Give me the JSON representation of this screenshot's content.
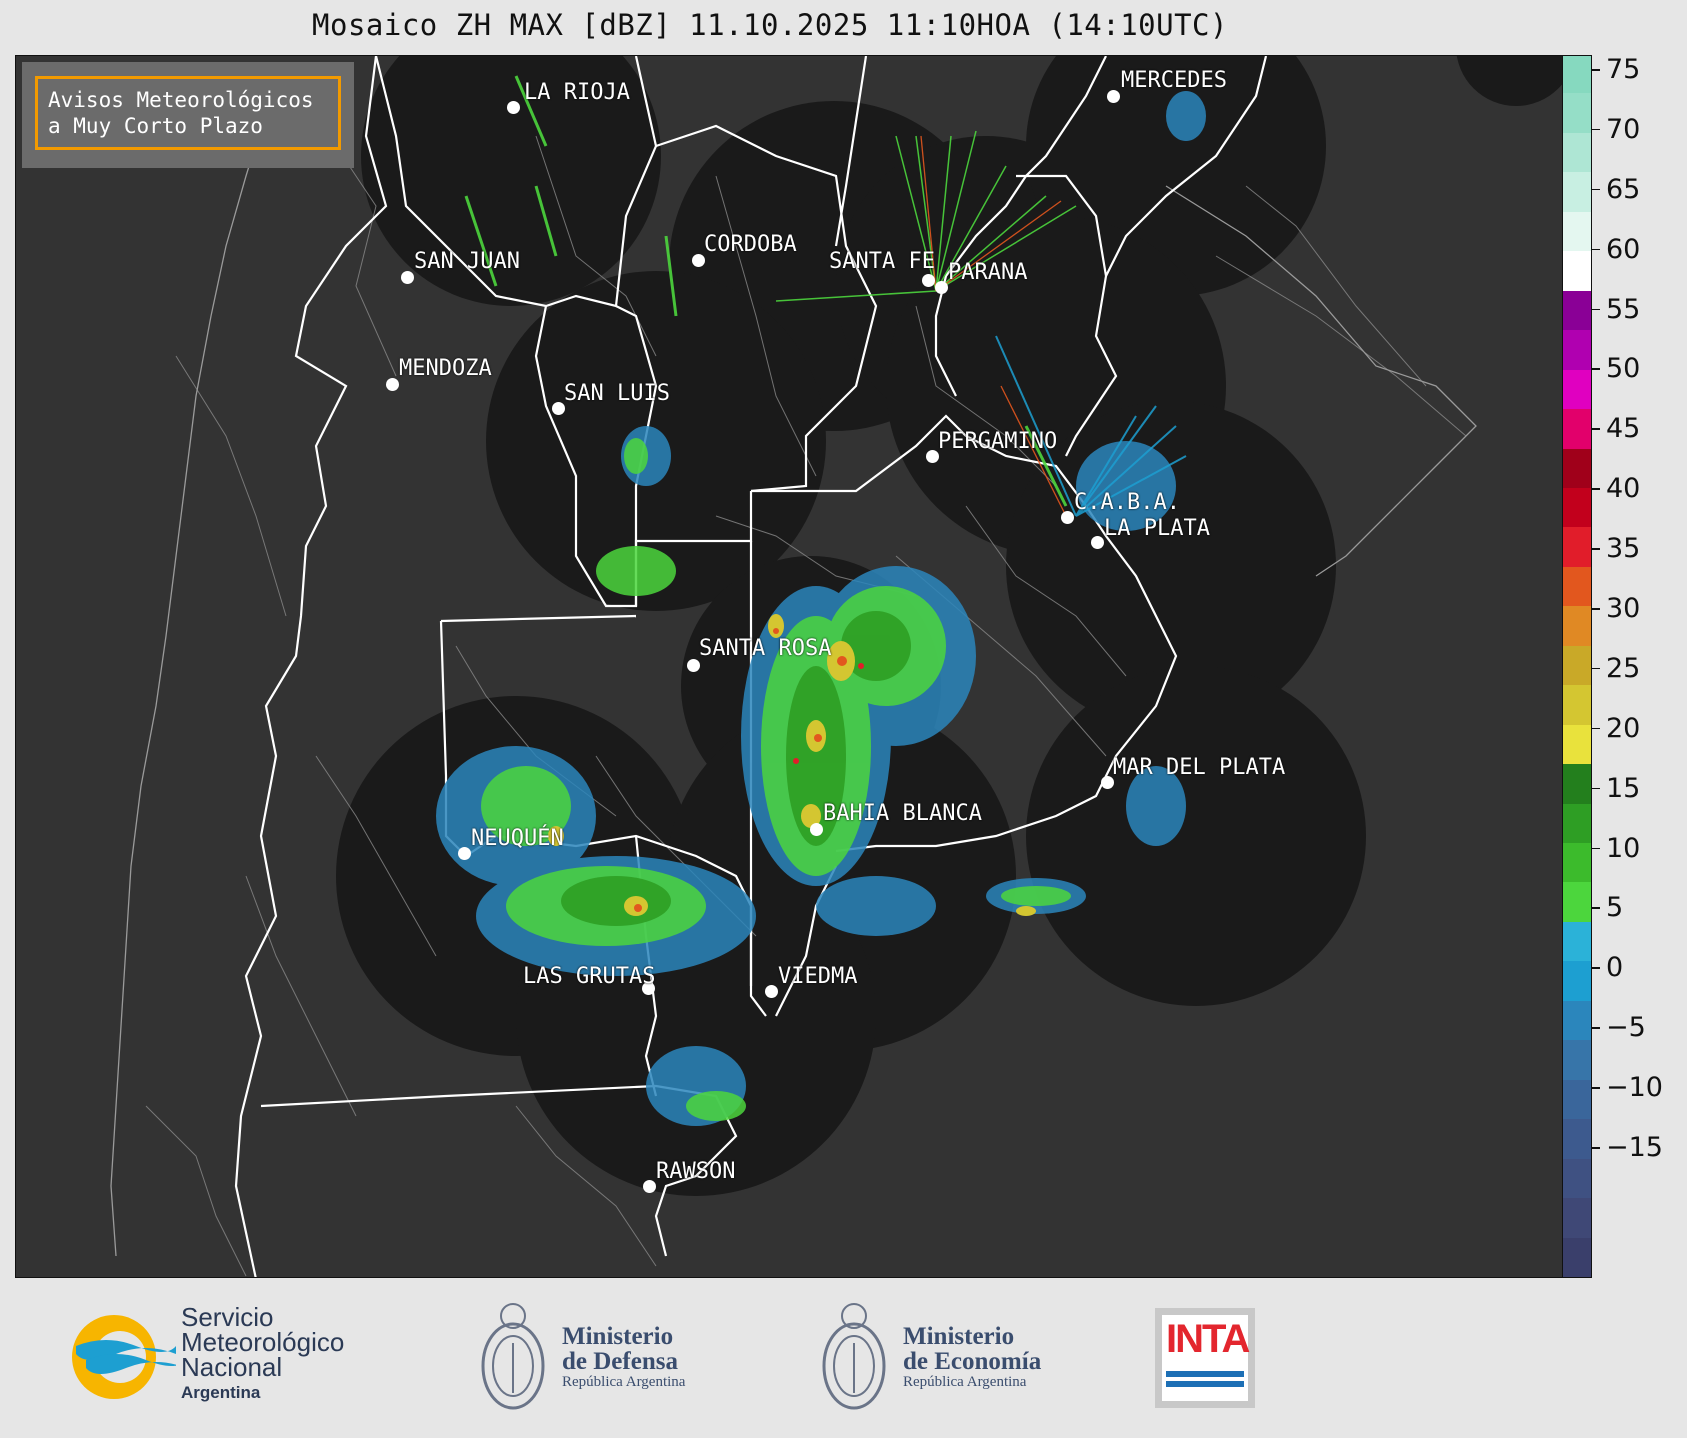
{
  "title": "Mosaico ZH MAX [dBZ] 11.10.2025 11:10HOA (14:10UTC)",
  "avisos": {
    "line1": "Avisos Meteorológicos",
    "line2": "a Muy Corto Plazo"
  },
  "colorbar": {
    "ticks": [
      "75",
      "70",
      "65",
      "60",
      "55",
      "50",
      "45",
      "40",
      "35",
      "30",
      "25",
      "20",
      "15",
      "10",
      "5",
      "0",
      "−5",
      "−10",
      "−15"
    ],
    "colors": [
      "#3a3f6b",
      "#3f4876",
      "#3f5182",
      "#3d5a8e",
      "#3a669b",
      "#3775a9",
      "#2b86bc",
      "#1d9fd1",
      "#2bb2d8",
      "#4cd63d",
      "#3cbb2c",
      "#2e9e24",
      "#237f1d",
      "#e9e23c",
      "#d4c631",
      "#c9a928",
      "#e08924",
      "#e2571e",
      "#e11d2a",
      "#c2001c",
      "#a0001a",
      "#e2006b",
      "#e000c0",
      "#b000b0",
      "#8a0096",
      "#ffffff",
      "#e4f7f0",
      "#c8efe2",
      "#aee6d4",
      "#95dec7",
      "#86d9bf"
    ]
  },
  "cities": [
    {
      "name": "LA RIOJA",
      "label": "LA RIOJA"
    },
    {
      "name": "MERCEDES",
      "label": "MERCEDES"
    },
    {
      "name": "SAN JUAN",
      "label": "SAN JUAN"
    },
    {
      "name": "CORDOBA",
      "label": "CORDOBA"
    },
    {
      "name": "SANTA FE",
      "label": "SANTA FE"
    },
    {
      "name": "PARANA",
      "label": "PARANA"
    },
    {
      "name": "MENDOZA",
      "label": "MENDOZA"
    },
    {
      "name": "SAN LUIS",
      "label": "SAN LUIS"
    },
    {
      "name": "PERGAMINO",
      "label": "PERGAMINO"
    },
    {
      "name": "CABA",
      "label": "C.A.B.A."
    },
    {
      "name": "LA PLATA",
      "label": "LA PLATA"
    },
    {
      "name": "SANTA ROSA",
      "label": "SANTA ROSA"
    },
    {
      "name": "MAR DEL PLATA",
      "label": "MAR DEL PLATA"
    },
    {
      "name": "BAHIA BLANCA",
      "label": "BAHIA BLANCA"
    },
    {
      "name": "NEUQUEN",
      "label": "NEUQUÉN"
    },
    {
      "name": "LAS GRUTAS",
      "label": "LAS GRUTAS"
    },
    {
      "name": "VIEDMA",
      "label": "VIEDMA"
    },
    {
      "name": "RAWSON",
      "label": "RAWSON"
    }
  ],
  "logos": {
    "smn": {
      "line1": "Servicio",
      "line2": "Meteorológico",
      "line3": "Nacional",
      "line4": "Argentina"
    },
    "defensa": {
      "line1": "Ministerio",
      "line2": "de Defensa",
      "line3": "República Argentina"
    },
    "economia": {
      "line1": "Ministerio",
      "line2": "de Economía",
      "line3": "República Argentina"
    },
    "inta": {
      "text": "INTA"
    }
  },
  "colors": {
    "radar_coverage": "#1a1a1a",
    "map_bg": "#333333",
    "province_border": "#ffffff",
    "dept_border": "#8a8a8a",
    "avisos_border": "#f29a00"
  }
}
